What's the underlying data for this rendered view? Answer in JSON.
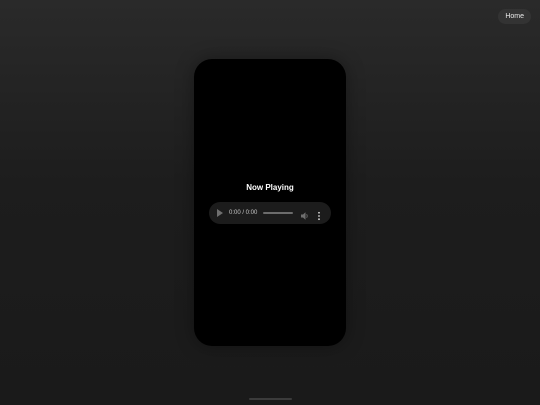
{
  "header": {
    "home_label": "Home"
  },
  "phone": {
    "title": "Now Playing"
  },
  "audio_player": {
    "time": "0:00 / 0:00",
    "progress": 0,
    "icons": {
      "play": "play-icon",
      "volume": "volume-icon",
      "menu": "more-vert-icon"
    }
  },
  "colors": {
    "background": "#1d1d1d",
    "phone": "#000000",
    "player": "#1c1c1c",
    "button": "#333333",
    "text": "#ffffff"
  }
}
